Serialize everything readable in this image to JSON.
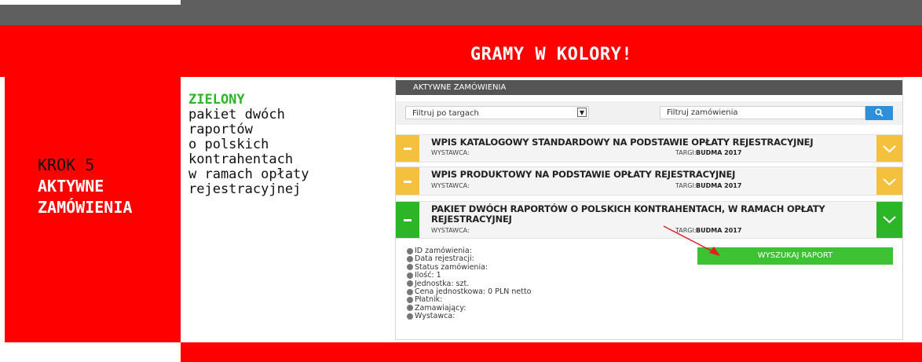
{
  "title": "GRAMY W KOLORY!",
  "step": {
    "line1": "KROK 5",
    "line2": "AKTYWNE",
    "line3": "ZAMÓWIENIA"
  },
  "description": {
    "color_word": "ZIELONY",
    "lines": [
      "pakiet dwóch",
      "raportów",
      "o polskich",
      "kontrahentach",
      "w ramach opłaty",
      "rejestracyjnej"
    ]
  },
  "colors": {
    "red": "#ff0000",
    "green": "#2db528",
    "yellow": "#f4c13f",
    "blue": "#2d90d9",
    "gray": "#5f5f5f"
  },
  "panel": {
    "header": "AKTYWNE ZAMÓWIENIA",
    "filter_select": "Filtruj po targach",
    "search_placeholder": "Filtruj zamówienia",
    "search_icon": "search-icon",
    "orders": [
      {
        "title": "WPIS KATALOGOWY STANDARDOWY NA PODSTAWIE OPŁATY REJESTRACYJNEJ",
        "exhibitor_label": "WYSTAWCA:",
        "fair_label": "TARGI:",
        "fair_value": "BUDMA 2017"
      },
      {
        "title": "WPIS PRODUKTOWY NA PODSTAWIE OPŁATY REJESTRACYJNEJ",
        "exhibitor_label": "WYSTAWCA:",
        "fair_label": "TARGI:",
        "fair_value": "BUDMA 2017"
      },
      {
        "title": "PAKIET DWÓCH RAPORTÓW O POLSKICH KONTRAHENTACH, W RAMACH OPŁATY REJESTRACYJNEJ",
        "exhibitor_label": "WYSTAWCA:",
        "fair_label": "TARGI:",
        "fair_value": "BUDMA 2017"
      }
    ],
    "details": [
      "ID zamówienia:",
      "Data rejestracji:",
      "Status zamówienia:",
      "Ilość: 1",
      "Jednostka: szt.",
      "Cena jednostkowa: 0 PLN netto",
      "Płatnik:",
      "Zamawiający:",
      "Wystawca:"
    ],
    "report_button": "WYSZUKAJ RAPORT"
  }
}
